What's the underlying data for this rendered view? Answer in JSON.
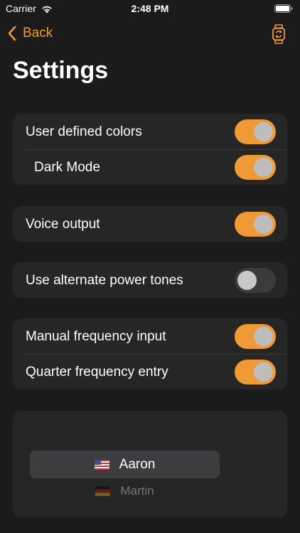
{
  "status_bar": {
    "carrier": "Carrier",
    "time": "2:48 PM"
  },
  "nav": {
    "back_label": "Back"
  },
  "page": {
    "title": "Settings"
  },
  "groups": [
    {
      "rows": [
        {
          "label": "User defined colors",
          "on": true
        },
        {
          "label": "Dark Mode",
          "on": true
        }
      ]
    },
    {
      "rows": [
        {
          "label": "Voice output",
          "on": true
        }
      ]
    },
    {
      "rows": [
        {
          "label": "Use alternate power tones",
          "on": false
        }
      ]
    },
    {
      "rows": [
        {
          "label": "Manual frequency input",
          "on": true
        },
        {
          "label": "Quarter frequency entry",
          "on": true
        }
      ]
    }
  ],
  "voice_picker": {
    "items": [
      {
        "name": "Aaron",
        "flag": "us-flag-icon"
      },
      {
        "name": "Martin",
        "flag": "de-flag-icon"
      }
    ]
  },
  "colors": {
    "accent": "#f09a37",
    "background": "#1b1b1b",
    "group": "#262626"
  }
}
